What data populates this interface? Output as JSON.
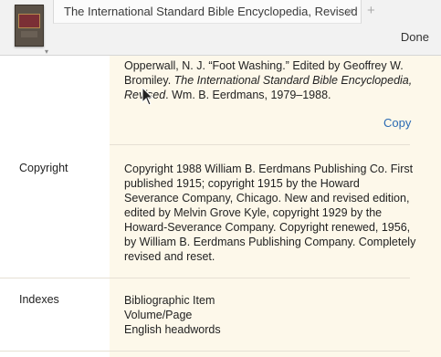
{
  "header": {
    "tab_title": "The International Standard Bible Encyclopedia, Revised",
    "close_glyph": "×",
    "new_tab_glyph": "+",
    "done_label": "Done",
    "cover_caret": "▾"
  },
  "citation": {
    "before_title": "Opperwall, N. J. “Foot Washing.” Edited by Geoffrey W. Bromiley. ",
    "title": "The International Standard Bible Encyclopedia, Revised",
    "after_title": ". Wm. B. Eerdmans, 1979–1988.",
    "copy_label": "Copy"
  },
  "rows": {
    "copyright": {
      "label": "Copyright",
      "value": "Copyright 1988 William B. Eerdmans Publishing Co. First published 1915; copyright 1915 by the Howard Severance Company, Chicago. New and revised edition, edited by Melvin Grove Kyle, copyright 1929 by the Howard-Severance Company. Copyright renewed, 1956, by William B. Eerdmans Publishing Company. Completely revised and reset."
    },
    "indexes": {
      "label": "Indexes",
      "items": [
        "Bibliographic Item",
        "Volume/Page",
        "English headwords"
      ]
    }
  },
  "colors": {
    "link": "#2a6ab3",
    "value_background": "#fdf8ea"
  }
}
